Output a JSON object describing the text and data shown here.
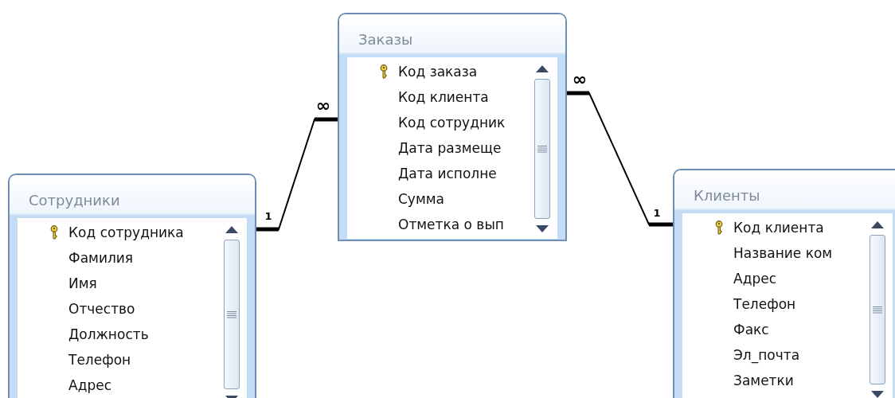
{
  "tables": [
    {
      "title": "Сотрудники",
      "fields": [
        {
          "name": "Код сотрудника",
          "key": true
        },
        {
          "name": "Фамилия",
          "key": false
        },
        {
          "name": "Имя",
          "key": false
        },
        {
          "name": "Отчество",
          "key": false
        },
        {
          "name": "Должность",
          "key": false
        },
        {
          "name": "Телефон",
          "key": false
        },
        {
          "name": "Адрес",
          "key": false
        }
      ]
    },
    {
      "title": "Заказы",
      "fields": [
        {
          "name": "Код заказа",
          "key": true
        },
        {
          "name": "Код клиента",
          "key": false
        },
        {
          "name": "Код сотрудник",
          "key": false
        },
        {
          "name": "Дата размеще",
          "key": false
        },
        {
          "name": "Дата исполне",
          "key": false
        },
        {
          "name": "Сумма",
          "key": false
        },
        {
          "name": "Отметка о вып",
          "key": false
        }
      ]
    },
    {
      "title": "Клиенты",
      "fields": [
        {
          "name": "Код клиента",
          "key": true
        },
        {
          "name": "Название ком",
          "key": false
        },
        {
          "name": "Адрес",
          "key": false
        },
        {
          "name": "Телефон",
          "key": false
        },
        {
          "name": "Факс",
          "key": false
        },
        {
          "name": "Эл_почта",
          "key": false
        },
        {
          "name": "Заметки",
          "key": false
        }
      ]
    }
  ],
  "relationships": [
    {
      "one_label": "1",
      "many_label": "∞"
    },
    {
      "one_label": "1",
      "many_label": "∞"
    }
  ]
}
